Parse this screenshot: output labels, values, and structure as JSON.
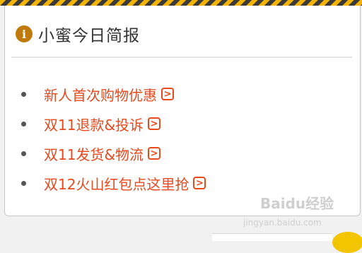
{
  "card": {
    "title": "小蜜今日简报",
    "items": [
      {
        "label": "新人首次购物优惠"
      },
      {
        "label": "双11退款&投诉"
      },
      {
        "label": "双11发货&物流"
      },
      {
        "label": "双12火山红包点这里抢"
      }
    ]
  },
  "watermark": {
    "text": "Baidu经验",
    "url": "jingyan.baidu.com"
  },
  "colors": {
    "accent": "#e8491d",
    "icon": "#c0790b",
    "stripe_yellow": "#f2b400"
  },
  "icons": {
    "header": "info-icon",
    "item": "chevron-right-icon"
  }
}
